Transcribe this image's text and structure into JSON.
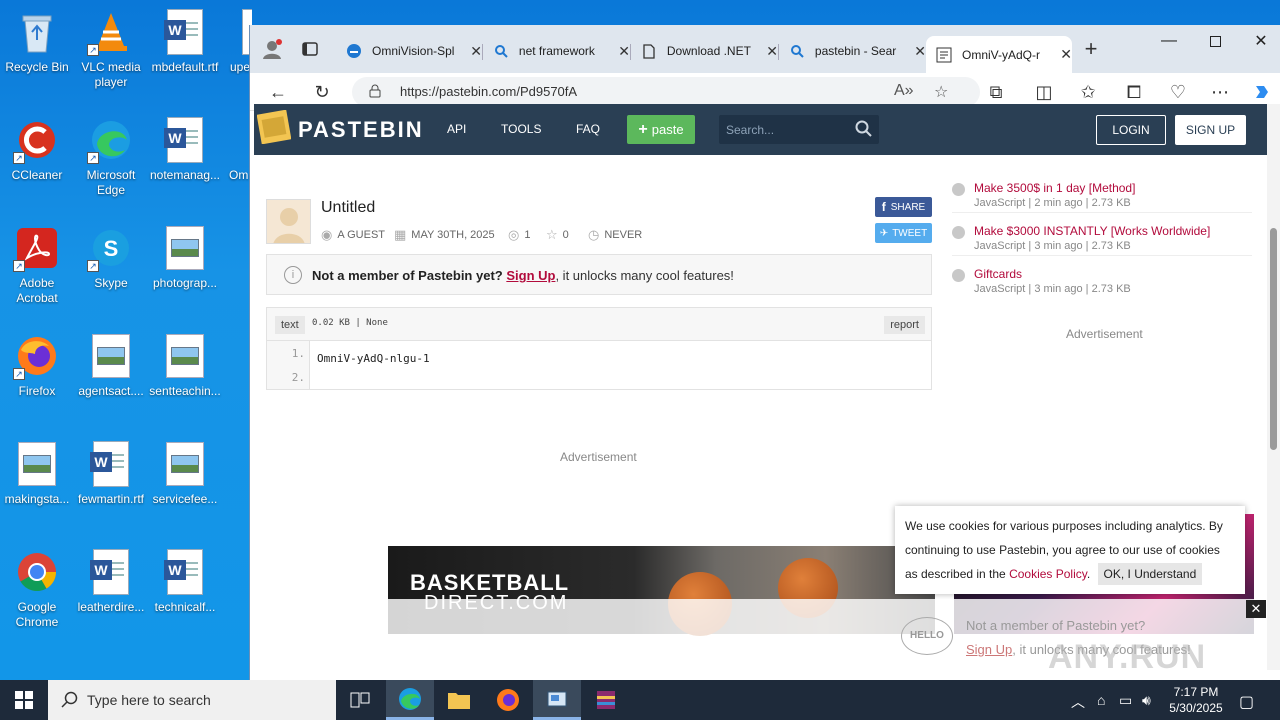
{
  "desktop": {
    "icons": [
      {
        "label": "Recycle Bin"
      },
      {
        "label": "VLC media player"
      },
      {
        "label": "mbdefault.rtf"
      },
      {
        "label": "upe"
      },
      {
        "label": "CCleaner"
      },
      {
        "label": "Microsoft Edge"
      },
      {
        "label": "notemanag..."
      },
      {
        "label": "Om"
      },
      {
        "label": "Adobe Acrobat"
      },
      {
        "label": "Skype"
      },
      {
        "label": "photograp..."
      },
      {
        "label": "Firefox"
      },
      {
        "label": "agentsact...."
      },
      {
        "label": "sentteachin..."
      },
      {
        "label": "makingsta..."
      },
      {
        "label": "fewmartin.rtf"
      },
      {
        "label": "servicefee..."
      },
      {
        "label": "Google Chrome"
      },
      {
        "label": "leatherdire..."
      },
      {
        "label": "technicalf..."
      }
    ]
  },
  "browser": {
    "tabs": [
      {
        "label": "OmniVision-Spl"
      },
      {
        "label": "net framework"
      },
      {
        "label": "Download .NET"
      },
      {
        "label": "pastebin - Sear"
      },
      {
        "label": "OmniV-yAdQ-r"
      }
    ],
    "url": "https://pastebin.com/Pd9570fA"
  },
  "pastebin": {
    "brand": "PASTEBIN",
    "nav": {
      "api": "API",
      "tools": "TOOLS",
      "faq": "FAQ"
    },
    "paste_button": "paste",
    "search_placeholder": "Search...",
    "login": "LOGIN",
    "signup": "SIGN UP",
    "paste": {
      "title": "Untitled",
      "author": "A GUEST",
      "date": "MAY 30TH, 2025",
      "views": "1",
      "stars": "0",
      "expires": "NEVER",
      "share": "SHARE",
      "tweet": "TWEET",
      "notice_bold": "Not a member of Pastebin yet?",
      "notice_link": "Sign Up",
      "notice_rest": ", it unlocks many cool features!",
      "syntax": "text",
      "size": "0.02 KB | None",
      "report": "report",
      "lines": [
        {
          "num": "1.",
          "text": "OmniV-yAdQ-nlgu-1"
        },
        {
          "num": "2.",
          "text": ""
        }
      ]
    },
    "advertisement": "Advertisement",
    "sidebar": [
      {
        "title": "Make 3500$ in 1 day [Method]",
        "meta": "JavaScript | 2 min ago | 2.73 KB"
      },
      {
        "title": "Make $3000 INSTANTLY [Works Worldwide]",
        "meta": "JavaScript | 3 min ago | 2.73 KB"
      },
      {
        "title": "Giftcards",
        "meta": "JavaScript | 3 min ago | 2.73 KB"
      }
    ],
    "banner": {
      "line1": "BASKETBALL",
      "line2": "DIRECT.COM"
    },
    "cookie": {
      "text": "We use cookies for various purposes including analytics. By continuing to use Pastebin, you agree to our use of cookies as described in the ",
      "link": "Cookies Policy",
      "button": "OK, I Understand"
    },
    "bottom_bar": {
      "line1": "Not a member of Pastebin yet?",
      "link": "Sign Up",
      "rest": ", it unlocks many cool features!",
      "hello": "HELLO"
    },
    "watermark": "ANY.RUN"
  },
  "taskbar": {
    "search_placeholder": "Type here to search",
    "time": "7:17 PM",
    "date": "5/30/2025"
  }
}
